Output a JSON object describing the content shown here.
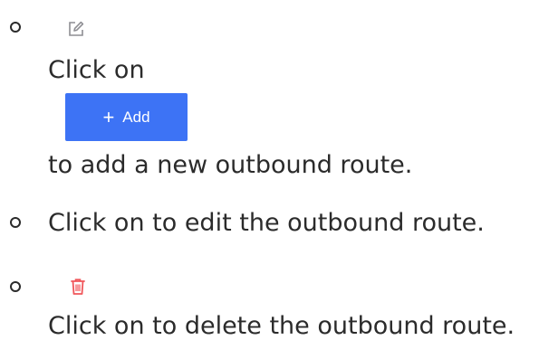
{
  "items": [
    {
      "icon": "edit-icon",
      "text_before": "Click on",
      "button_label": "Add",
      "button_icon": "plus-icon",
      "text_after": "to add a new outbound route."
    },
    {
      "text": "Click on to edit the outbound route."
    },
    {
      "icon": "trash-icon",
      "text": "Click on to delete the outbound route."
    }
  ],
  "colors": {
    "text": "#2b2b2b",
    "button_bg": "#3d73f5",
    "edit_icon": "#8e8e93",
    "trash_icon": "#f0565a"
  }
}
